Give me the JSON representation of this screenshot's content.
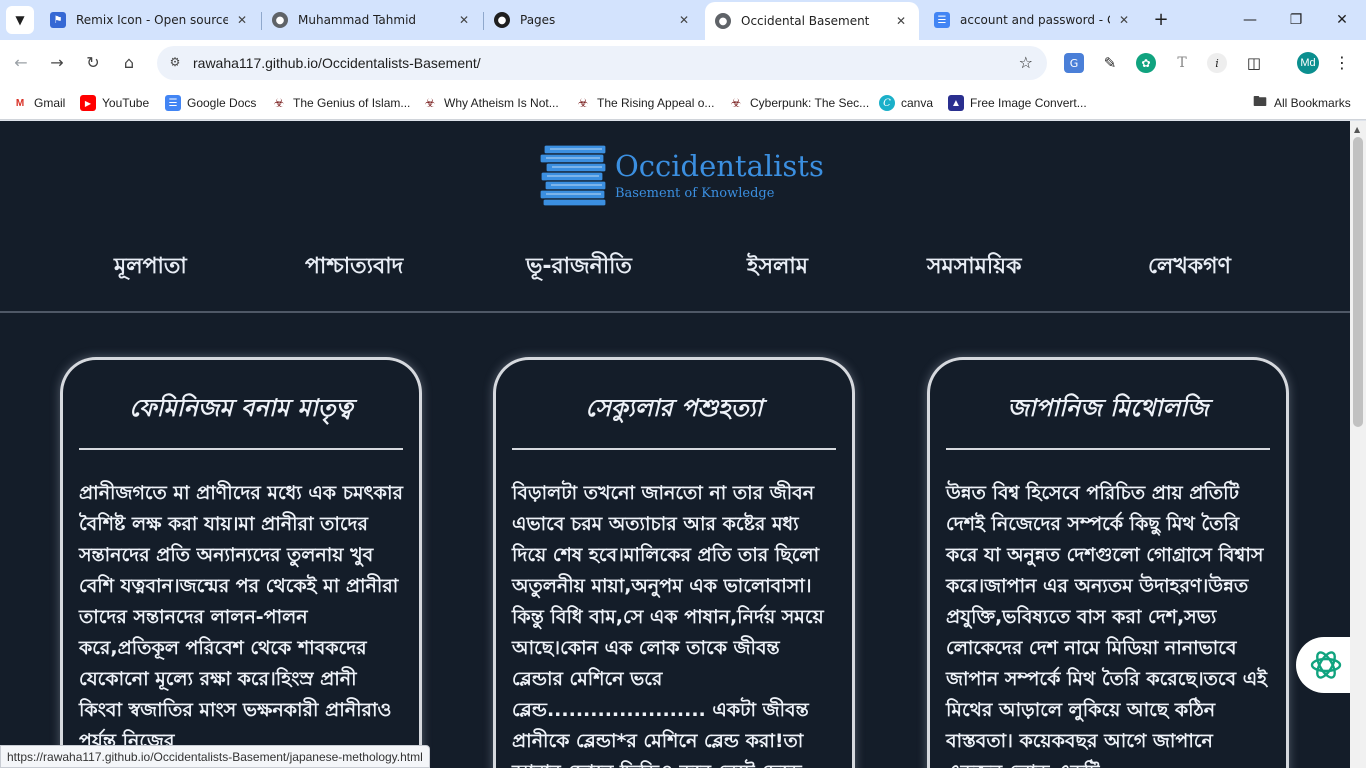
{
  "browser": {
    "tabs": [
      {
        "title": "Remix Icon - Open source ic",
        "icon": "remix-icon",
        "active": false
      },
      {
        "title": "Muhammad Tahmid",
        "icon": "globe-icon",
        "active": false
      },
      {
        "title": "Pages",
        "icon": "github-icon",
        "active": false
      },
      {
        "title": "Occidental Basement",
        "icon": "globe-icon",
        "active": true
      },
      {
        "title": "account and password - Goo",
        "icon": "docs-icon",
        "active": false
      }
    ],
    "url": "rawaha117.github.io/Occidentalists-Basement/",
    "profile_initials": "Md",
    "bookmarks": [
      {
        "label": "Gmail",
        "icon": "gmail-icon"
      },
      {
        "label": "YouTube",
        "icon": "youtube-icon"
      },
      {
        "label": "Google Docs",
        "icon": "docs-icon"
      },
      {
        "label": "The Genius of Islam...",
        "icon": "theater-icon"
      },
      {
        "label": "Why Atheism Is Not...",
        "icon": "theater-icon"
      },
      {
        "label": "The Rising Appeal o...",
        "icon": "theater-icon"
      },
      {
        "label": "Cyberpunk: The Sec...",
        "icon": "theater-icon"
      },
      {
        "label": "canva",
        "icon": "canva-icon"
      },
      {
        "label": "Free Image Convert...",
        "icon": "converter-icon"
      }
    ],
    "all_bookmarks_label": "All Bookmarks",
    "status_url": "https://rawaha117.github.io/Occidentalists-Basement/japanese-methology.html"
  },
  "site": {
    "logo_title": "Occidentalists",
    "logo_subtitle": "Basement of Knowledge",
    "accent_color": "#3b8fe0",
    "background_color": "#141d29",
    "menu": [
      "মূলপাতা",
      "পাশ্চাত্যবাদ",
      "ভূ-রাজনীতি",
      "ইসলাম",
      "সমসাময়িক",
      "লেখকগণ"
    ]
  },
  "cards": [
    {
      "title": "ফেমিনিজম বনাম মাতৃত্ব",
      "body": "প্রানীজগতে মা প্রাণীদের মধ্যে এক চমৎকার বৈশিষ্ট লক্ষ করা যায়।মা প্রানীরা তাদের সন্তানদের প্রতি অন্যান্যদের তুলনায় খুব বেশি যত্নবান।জন্মের পর থেকেই মা প্রানীরা তাদের সন্তানদের লালন-পালন করে,প্রতিকূল পরিবেশ থেকে শাবকদের যেকোনো মূল্যে রক্ষা করে।হিংস্র প্রানী কিংবা স্বজাতির মাংস ভক্ষনকারী প্রানীরাও পর্যন্ত নিজের"
    },
    {
      "title": "সেক্যুলার পশুহত্যা",
      "body": "বিড়ালটা তখনো জানতো না তার জীবন এভাবে চরম অত্যাচার আর কষ্টের মধ্য দিয়ে শেষ হবে।মালিকের প্রতি তার ছিলো অতুলনীয় মায়া,অনুপম এক ভালোবাসা। কিন্তু বিধি বাম,সে এক পাষান,নির্দয় সময়ে আছে।কোন এক লোক তাকে জীবন্ত ব্লেন্ডার মেশিনে ভরে ব্লেন্ড...................... একটা জীবন্ত প্রানীকে ব্লেন্ডা*র মেশিনে ব্লেন্ড করা!তা আবার ফোনে ভিডিও করে নেটে ছেড়ে"
    },
    {
      "title": "জাপানিজ মিথোলজি",
      "body": "উন্নত বিশ্ব হিসেবে পরিচিত প্রায় প্রতিটি দেশই নিজেদের সম্পর্কে কিছু মিথ তৈরি করে যা অনুন্নত দেশগুলো গোগ্রাসে বিশ্বাস করে।জাপান এর অন্যতম উদাহরণ।উন্নত প্রযুক্তি,ভবিষ্যতে বাস করা দেশ,সভ্য লোকেদের দেশ নামে মিডিয়া নানাভাবে জাপান সম্পর্কে মিথ তৈরি করেছে।তবে এই মিথের আড়ালে লুকিয়ে আছে কঠিন বাস্তবতা। কয়েকবছর আগে জাপানে একজন লোক একটি"
    }
  ]
}
